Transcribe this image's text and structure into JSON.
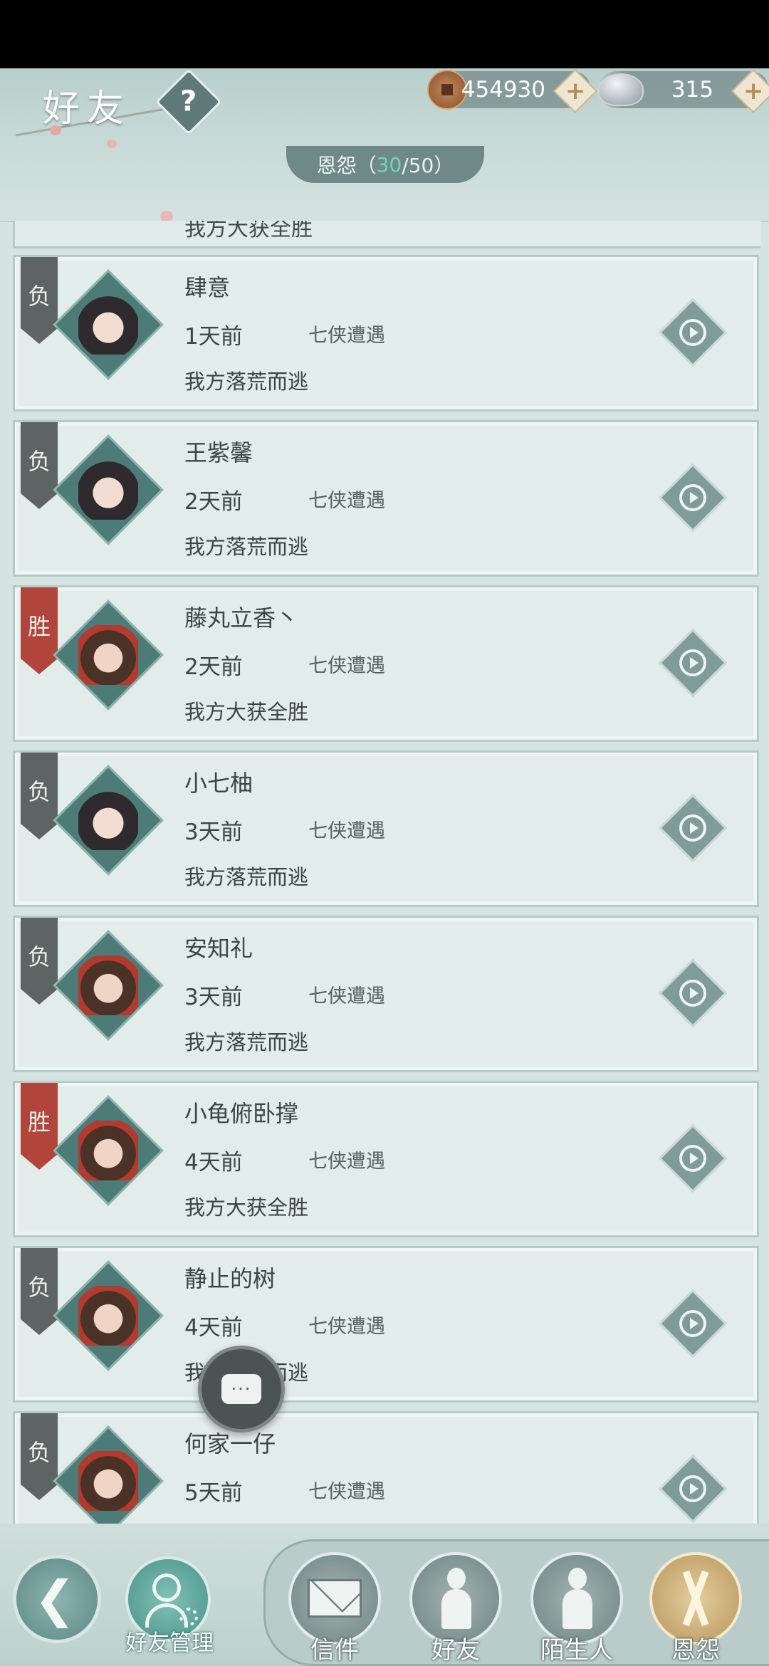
{
  "header": {
    "title": "好友",
    "help_symbol": "?",
    "copper": "454930",
    "silver": "315",
    "plus_symbol": "+",
    "tab_label": "恩怨",
    "tab_open": "（",
    "tab_count": "30",
    "tab_total": "/50）"
  },
  "partial_top_result": "我方大获全胜",
  "records": [
    {
      "badge": "负",
      "name": "肆意",
      "time": "1天前",
      "mode": "七侠遭遇",
      "result": "我方落荒而逃"
    },
    {
      "badge": "负",
      "name": "王紫馨",
      "time": "2天前",
      "mode": "七侠遭遇",
      "result": "我方落荒而逃"
    },
    {
      "badge": "胜",
      "name": "藤丸立香丶",
      "time": "2天前",
      "mode": "七侠遭遇",
      "result": "我方大获全胜"
    },
    {
      "badge": "负",
      "name": "小七柚",
      "time": "3天前",
      "mode": "七侠遭遇",
      "result": "我方落荒而逃"
    },
    {
      "badge": "负",
      "name": "安知礼",
      "time": "3天前",
      "mode": "七侠遭遇",
      "result": "我方落荒而逃"
    },
    {
      "badge": "胜",
      "name": "小龟俯卧撑",
      "time": "4天前",
      "mode": "七侠遭遇",
      "result": "我方大获全胜"
    },
    {
      "badge": "负",
      "name": "静止的树",
      "time": "4天前",
      "mode": "七侠遭遇",
      "result": "我方落荒而逃"
    },
    {
      "badge": "负",
      "name": "何家一仔",
      "time": "5天前",
      "mode": "七侠遭遇",
      "result": ""
    }
  ],
  "chat_fab_label": "···",
  "bottom": {
    "back_symbol": "❮",
    "manage_label": "好友管理",
    "tabs": [
      "信件",
      "好友",
      "陌生人",
      "恩怨"
    ]
  },
  "colors": {
    "win_badge": "#b1443b",
    "lose_badge": "#5e6463",
    "count_accent": "#6cd6b9",
    "active_tab": "#b8955a"
  },
  "icons": {
    "copper": "copper-coin-icon",
    "silver": "silver-ingot-icon",
    "replay": "replay-icon",
    "mail": "envelope-icon",
    "friend": "person-icon",
    "stranger": "person-icon",
    "enmity": "crossed-swords-icon"
  }
}
